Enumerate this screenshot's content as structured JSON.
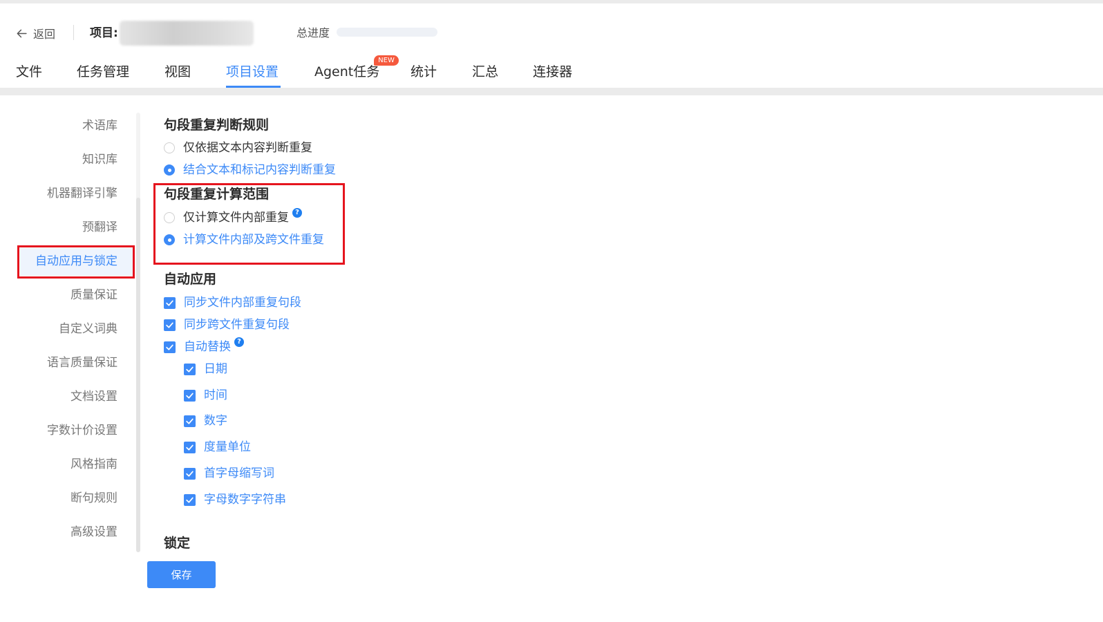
{
  "header": {
    "back_label": "返回",
    "project_label": "项目:",
    "progress_label": "总进度",
    "progress_value": 0.0
  },
  "tabs": [
    {
      "label": "文件"
    },
    {
      "label": "任务管理"
    },
    {
      "label": "视图"
    },
    {
      "label": "项目设置",
      "active": true
    },
    {
      "label": "Agent任务",
      "badge": "NEW"
    },
    {
      "label": "统计"
    },
    {
      "label": "汇总"
    },
    {
      "label": "连接器"
    }
  ],
  "sidebar": {
    "items": [
      {
        "label": "术语库"
      },
      {
        "label": "知识库"
      },
      {
        "label": "机器翻译引擎"
      },
      {
        "label": "预翻译"
      },
      {
        "label": "自动应用与锁定",
        "active": true
      },
      {
        "label": "质量保证"
      },
      {
        "label": "自定义词典"
      },
      {
        "label": "语言质量保证"
      },
      {
        "label": "文档设置"
      },
      {
        "label": "字数计价设置"
      },
      {
        "label": "风格指南"
      },
      {
        "label": "断句规则"
      },
      {
        "label": "高级设置"
      }
    ]
  },
  "main": {
    "repeat_rule": {
      "title": "句段重复判断规则",
      "options": [
        {
          "label": "仅依据文本内容判断重复",
          "selected": false
        },
        {
          "label": "结合文本和标记内容判断重复",
          "selected": true
        }
      ]
    },
    "repeat_scope": {
      "title": "句段重复计算范围",
      "options": [
        {
          "label": "仅计算文件内部重复",
          "selected": false,
          "help": "?"
        },
        {
          "label": "计算文件内部及跨文件重复",
          "selected": true
        }
      ]
    },
    "auto_apply": {
      "title": "自动应用",
      "items": [
        {
          "label": "同步文件内部重复句段",
          "checked": true
        },
        {
          "label": "同步跨文件重复句段",
          "checked": true
        },
        {
          "label": "自动替换",
          "checked": true,
          "help": "?"
        }
      ],
      "sub_items": [
        {
          "label": "日期",
          "checked": true
        },
        {
          "label": "时间",
          "checked": true
        },
        {
          "label": "数字",
          "checked": true
        },
        {
          "label": "度量单位",
          "checked": true
        },
        {
          "label": "首字母缩写词",
          "checked": true
        },
        {
          "label": "字母数字字符串",
          "checked": true
        }
      ]
    },
    "lock": {
      "title": "锁定"
    },
    "save_label": "保存"
  },
  "colors": {
    "accent": "#3d8af7",
    "highlight_box": "#e5141e",
    "new_badge": "#f5593d"
  }
}
